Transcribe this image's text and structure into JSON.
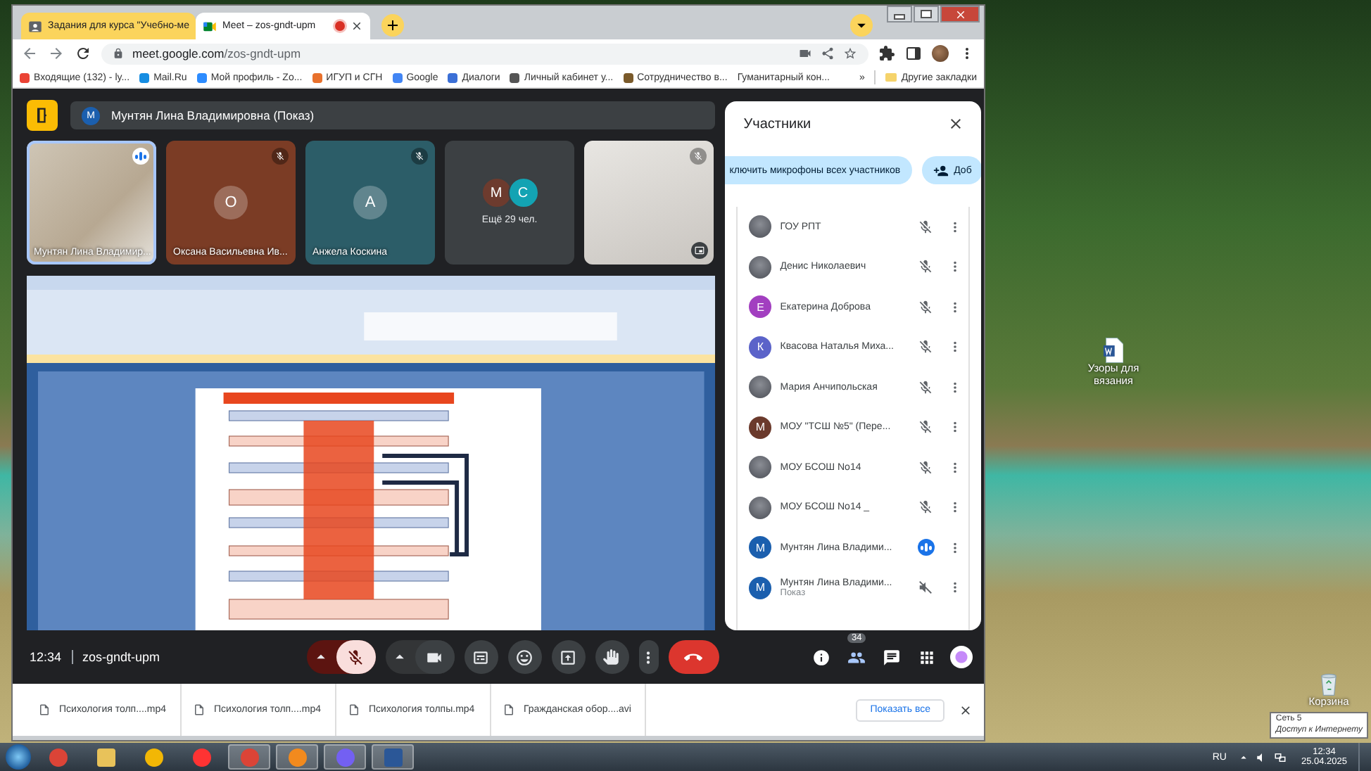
{
  "browser": {
    "tabs": [
      {
        "title": "Задания для курса \"Учебно-ме",
        "selected": false,
        "recording": false
      },
      {
        "title": "Meet – zos-gndt-upm",
        "selected": true,
        "recording": true
      }
    ],
    "url_host": "meet.google.com",
    "url_path": "/zos-gndt-upm",
    "bookmarks": [
      {
        "label": "Входящие (132) - ly...",
        "color": "#ea4335"
      },
      {
        "label": "Mail.Ru",
        "color": "#168de2"
      },
      {
        "label": "Мой профиль - Zo...",
        "color": "#2d8cff"
      },
      {
        "label": "ИГУП и СГН",
        "color": "#e8712c"
      },
      {
        "label": "Google",
        "color": "#4285f4"
      },
      {
        "label": "Диалоги",
        "color": "#3b6fd6"
      },
      {
        "label": "Личный кабинет у...",
        "color": "#555555"
      },
      {
        "label": "Сотрудничество в...",
        "color": "#7a5a2a"
      },
      {
        "label": "Гуманитарный кон..."
      }
    ],
    "overflow": "»",
    "other_bookmarks": "Другие закладки"
  },
  "meet": {
    "presenter": {
      "letter": "М",
      "name": "Мунтян Лина Владимировна (Показ)"
    },
    "tiles": [
      {
        "kind": "video",
        "label": "Мунтян Лина Владимир...",
        "muted": false,
        "highlighted": true
      },
      {
        "kind": "avatar",
        "letter": "О",
        "label": "Оксана Васильевна Ив...",
        "color": "#7b3c25",
        "muted": true,
        "highlighted": false
      },
      {
        "kind": "avatar",
        "letter": "А",
        "label": "Анжела Коскина",
        "color": "#2c5d68",
        "muted": true,
        "highlighted": false
      },
      {
        "kind": "more",
        "avatars": [
          {
            "letter": "М",
            "color": "#6d3b2e"
          },
          {
            "letter": "С",
            "color": "#13a3b3"
          }
        ],
        "label": "Ещё 29 чел.",
        "highlighted": false
      },
      {
        "kind": "video",
        "muted": true,
        "highlighted": false
      }
    ],
    "panel": {
      "title": "Участники",
      "mute_all": "ключить микрофоны всех участников",
      "add": "Доб",
      "participants": [
        {
          "kind": "person",
          "name": "ГОУ РПТ",
          "avatar": {
            "kind": "photo"
          },
          "muted": true
        },
        {
          "kind": "person",
          "name": "Денис Николаевич",
          "avatar": {
            "kind": "photo"
          },
          "muted": true
        },
        {
          "kind": "person",
          "name": "Екатерина Доброва",
          "avatar": {
            "kind": "letter",
            "letter": "Е",
            "color": "#a23fc0"
          },
          "muted": true
        },
        {
          "kind": "person",
          "name": "Квасова Наталья Миха...",
          "avatar": {
            "kind": "letter",
            "letter": "К",
            "color": "#5b63c9"
          },
          "muted": true
        },
        {
          "kind": "person",
          "name": "Мария Анчипольская",
          "avatar": {
            "kind": "photo"
          },
          "muted": true
        },
        {
          "kind": "person",
          "name": "МОУ \"ТСШ №5\" (Пере...",
          "avatar": {
            "kind": "letter",
            "letter": "М",
            "color": "#6b3a2c"
          },
          "muted": true
        },
        {
          "kind": "person",
          "name": "МОУ БСОШ No14",
          "avatar": {
            "kind": "photo"
          },
          "muted": true
        },
        {
          "kind": "person",
          "name": "МОУ БСОШ No14 _",
          "avatar": {
            "kind": "photo"
          },
          "muted": true
        },
        {
          "kind": "person",
          "name": "Мунтян Лина Владими...",
          "avatar": {
            "kind": "letter",
            "letter": "М",
            "color": "#1b5fae"
          },
          "muted": false
        },
        {
          "kind": "presentation",
          "name": "Мунтян Лина Владими...",
          "subtitle": "Показ",
          "avatar": {
            "kind": "letter",
            "letter": "М",
            "color": "#1b5fae"
          },
          "muted": true
        }
      ]
    },
    "time": "12:34",
    "code": "zos-gndt-upm",
    "controls": [
      {
        "kind": "mic",
        "on": false
      },
      {
        "kind": "camera",
        "on": true
      },
      {
        "kind": "captions"
      },
      {
        "kind": "reactions"
      },
      {
        "kind": "present"
      },
      {
        "kind": "hand"
      },
      {
        "kind": "more"
      },
      {
        "kind": "end"
      }
    ],
    "side_buttons": [
      {
        "kind": "info",
        "selected": false
      },
      {
        "kind": "people",
        "badge": "34",
        "selected": true
      },
      {
        "kind": "chat",
        "selected": false
      },
      {
        "kind": "apps",
        "selected": false
      }
    ]
  },
  "downloads": {
    "items": [
      "Психология толп....mp4",
      "Психология толп....mp4",
      "Психология толпы.mp4",
      "Гражданская обор....avi"
    ],
    "show_all": "Показать все"
  },
  "desktop": {
    "icons": [
      {
        "kind": "document",
        "label": "Узоры для вязания"
      },
      {
        "kind": "bin",
        "label": "Корзина"
      }
    ],
    "tooltip": {
      "title": "Сеть 5",
      "text": "Доступ к Интернету"
    }
  },
  "taskbar": {
    "apps": [
      {
        "kind": "chrome",
        "active": false
      },
      {
        "kind": "folder",
        "active": false
      },
      {
        "kind": "player",
        "active": false
      },
      {
        "kind": "yandex",
        "active": false
      },
      {
        "kind": "chrome",
        "active": true
      },
      {
        "kind": "launcher",
        "active": true
      },
      {
        "kind": "viber",
        "active": true
      },
      {
        "kind": "word",
        "active": true
      }
    ],
    "lang": "RU",
    "time": "12:34",
    "date": "25.04.2025"
  }
}
